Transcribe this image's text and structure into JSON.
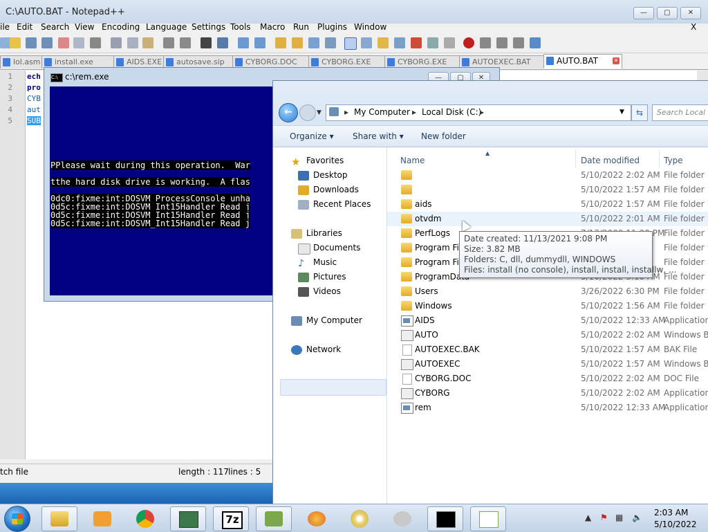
{
  "notepad": {
    "title": "C:\\AUTO.BAT - Notepad++",
    "menu": [
      "ile",
      "Edit",
      "Search",
      "View",
      "Encoding",
      "Language",
      "Settings",
      "Tools",
      "Macro",
      "Run",
      "Plugins",
      "Window"
    ],
    "close_x": "X",
    "tabs": [
      "lol.asm",
      "install.exe",
      "AIDS.EXE",
      "autosave.sip",
      "CYBORG.DOC",
      "CYBORG.EXE",
      "CYBORG.EXE",
      "AUTOEXEC.BAT",
      "AUTO.BAT"
    ],
    "line_numbers": [
      "1",
      "2",
      "3",
      "4",
      "5"
    ],
    "code_lines": [
      "ech",
      "pro",
      "CYB",
      "aut",
      "SUB"
    ],
    "status": {
      "type": "tch file",
      "length": "length : 117",
      "lines": "lines : 5"
    }
  },
  "console": {
    "title": "c:\\rem.exe",
    "icon_text": "C:\\",
    "lines": [
      "PPlease wait during this operation.  War",
      "tthe hard disk drive is working.  A flas",
      "0dc0:fixme:int:DOSVM_ProcessConsole unha",
      "0d5c:fixme:int:DOSVM_Int15Handler Read j",
      "0d5c:fixme:int:DOSVM_Int15Handler Read j",
      "0d5c:fixme:int:DOSVM_Int15Handler Read j"
    ]
  },
  "explorer": {
    "address": [
      "My Computer",
      "Local Disk (C:)"
    ],
    "search_placeholder": "Search Local Di",
    "commands": {
      "organize": "Organize",
      "share": "Share with",
      "new_folder": "New folder"
    },
    "nav": {
      "favorites": "Favorites",
      "desktop": "Desktop",
      "downloads": "Downloads",
      "recent": "Recent Places",
      "libraries": "Libraries",
      "documents": "Documents",
      "music": "Music",
      "pictures": "Pictures",
      "videos": "Videos",
      "computer": "My Computer",
      "network": "Network"
    },
    "columns": {
      "name": "Name",
      "date": "Date modified",
      "type": "Type"
    },
    "files": [
      {
        "name": "",
        "date": "5/10/2022 2:02 AM",
        "type": "File folder",
        "icon": "folder"
      },
      {
        "name": "",
        "date": "5/10/2022 1:57 AM",
        "type": "File folder",
        "icon": "folder"
      },
      {
        "name": "aids",
        "date": "5/10/2022 1:57 AM",
        "type": "File folder",
        "icon": "folder"
      },
      {
        "name": "otvdm",
        "date": "5/10/2022 2:01 AM",
        "type": "File folder",
        "icon": "folder"
      },
      {
        "name": "PerfLogs",
        "date": "7/13/2009 11:20 PM",
        "type": "File folder",
        "icon": "folder"
      },
      {
        "name": "Program Files",
        "date": "",
        "type": "File folder",
        "icon": "folder"
      },
      {
        "name": "Program Files",
        "date": "",
        "type": "File folder",
        "icon": "folder"
      },
      {
        "name": "ProgramData",
        "date": "5/10/2022 3:18 AM",
        "type": "File folder",
        "icon": "folder"
      },
      {
        "name": "Users",
        "date": "3/26/2022 6:30 PM",
        "type": "File folder",
        "icon": "folder"
      },
      {
        "name": "Windows",
        "date": "5/10/2022 1:56 AM",
        "type": "File folder",
        "icon": "folder"
      },
      {
        "name": "AIDS",
        "date": "5/10/2022 12:33 AM",
        "type": "Application",
        "icon": "app"
      },
      {
        "name": "AUTO",
        "date": "5/10/2022 2:02 AM",
        "type": "Windows Ba",
        "icon": "bat"
      },
      {
        "name": "AUTOEXEC.BAK",
        "date": "5/10/2022 1:57 AM",
        "type": "BAK File",
        "icon": "doc"
      },
      {
        "name": "AUTOEXEC",
        "date": "5/10/2022 1:57 AM",
        "type": "Windows Ba",
        "icon": "bat"
      },
      {
        "name": "CYBORG.DOC",
        "date": "5/10/2022 2:02 AM",
        "type": "DOC File",
        "icon": "doc"
      },
      {
        "name": "CYBORG",
        "date": "5/10/2022 2:02 AM",
        "type": "Application",
        "icon": "bat"
      },
      {
        "name": "rem",
        "date": "5/10/2022 12:33 AM",
        "type": "Application",
        "icon": "app"
      }
    ],
    "tooltip": [
      "Date created: 11/13/2021 9:08 PM",
      "Size: 3.82 MB",
      "Folders: C, dll, dummydll, WINDOWS",
      "Files: install (no console), install, install, installw, ..."
    ]
  },
  "taskbar": {
    "time": "2:03 AM",
    "date": "5/10/2022",
    "sevenzip_label": "7z"
  }
}
